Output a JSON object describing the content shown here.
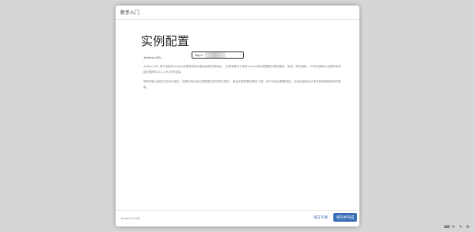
{
  "dialog": {
    "title": "新手入门",
    "heading": "实例配置",
    "url_label": "Jenkins URL:",
    "url_value": "http://...",
    "paragraphs": [
      "Jenkins URL 用于给各种Jenkins资源提供绝对路径链接的根地址。 这意味着对于很多Jenkins特色是需要正确设置的，例如：邮件通知、PR状态更新以及提供给构建步骤的BUILD_URL环境变量。",
      "推荐的默认值显示在尚未保存，如果可能的话这是根据当前请求生成的。 最佳实践是要设置这个值，用户可能会需要用到。这将会避免在分享或者查看链接时的困惑。"
    ]
  },
  "footer": {
    "version": "Jenkins 2.289",
    "skip_label": "现在不要",
    "save_label": "保存并完成"
  }
}
